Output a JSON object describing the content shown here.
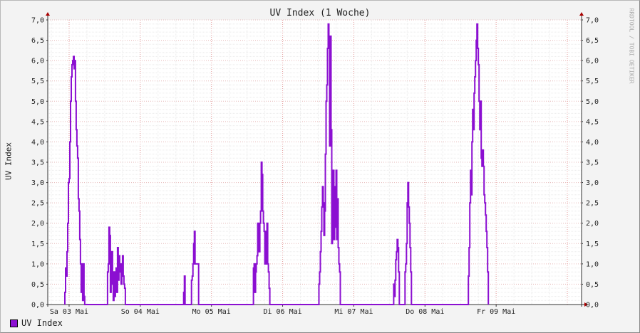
{
  "chart_data": {
    "type": "line",
    "title": "UV Index (1 Woche)",
    "ylabel": "UV Index",
    "watermark": "RRDTOOL / TOBI OETIKER",
    "ylim": [
      0,
      7
    ],
    "y_ticks": [
      "0,0",
      "0,5",
      "1,0",
      "1,5",
      "2,0",
      "2,5",
      "3,0",
      "3,5",
      "4,0",
      "4,5",
      "5,0",
      "5,5",
      "6,0",
      "6,5",
      "7,0"
    ],
    "xlim": [
      -0.3,
      7.2
    ],
    "x_ticks": [
      {
        "x": 0.0,
        "label": "Sa 03 Mai"
      },
      {
        "x": 1.0,
        "label": "So 04 Mai"
      },
      {
        "x": 2.0,
        "label": "Mo 05 Mai"
      },
      {
        "x": 3.0,
        "label": "Di 06 Mai"
      },
      {
        "x": 4.0,
        "label": "Mi 07 Mai"
      },
      {
        "x": 5.0,
        "label": "Do 08 Mai"
      },
      {
        "x": 6.0,
        "label": "Fr 09 Mai"
      }
    ],
    "grid": true,
    "legend": "bottom-left",
    "series": [
      {
        "name": "UV Index",
        "color": "#8b0fd1",
        "points": [
          [
            -0.06,
            0
          ],
          [
            -0.06,
            0.3
          ],
          [
            -0.05,
            0.9
          ],
          [
            -0.04,
            0.7
          ],
          [
            -0.03,
            1.3
          ],
          [
            -0.02,
            2.0
          ],
          [
            -0.01,
            3.0
          ],
          [
            0.0,
            3.1
          ],
          [
            0.01,
            4.0
          ],
          [
            0.02,
            5.0
          ],
          [
            0.03,
            5.6
          ],
          [
            0.04,
            5.9
          ],
          [
            0.05,
            6.0
          ],
          [
            0.06,
            6.1
          ],
          [
            0.07,
            5.8
          ],
          [
            0.08,
            6.0
          ],
          [
            0.09,
            5.0
          ],
          [
            0.1,
            4.3
          ],
          [
            0.11,
            3.9
          ],
          [
            0.12,
            3.6
          ],
          [
            0.13,
            2.6
          ],
          [
            0.14,
            2.3
          ],
          [
            0.15,
            1.6
          ],
          [
            0.16,
            1.0
          ],
          [
            0.17,
            0.3
          ],
          [
            0.18,
            1.0
          ],
          [
            0.19,
            0.1
          ],
          [
            0.2,
            1.0
          ],
          [
            0.21,
            0.2
          ],
          [
            0.22,
            0
          ],
          [
            0.54,
            0
          ],
          [
            0.54,
            0.8
          ],
          [
            0.55,
            1.0
          ],
          [
            0.56,
            1.9
          ],
          [
            0.57,
            1.7
          ],
          [
            0.58,
            0.3
          ],
          [
            0.59,
            1.1
          ],
          [
            0.6,
            1.3
          ],
          [
            0.61,
            0.5
          ],
          [
            0.62,
            0.1
          ],
          [
            0.63,
            0.8
          ],
          [
            0.64,
            0.2
          ],
          [
            0.65,
            0.6
          ],
          [
            0.66,
            0.9
          ],
          [
            0.67,
            0.3
          ],
          [
            0.68,
            1.4
          ],
          [
            0.69,
            0.6
          ],
          [
            0.7,
            1.2
          ],
          [
            0.71,
            0.8
          ],
          [
            0.72,
            1.0
          ],
          [
            0.73,
            0.5
          ],
          [
            0.74,
            0.9
          ],
          [
            0.75,
            1.2
          ],
          [
            0.76,
            0.7
          ],
          [
            0.77,
            0.5
          ],
          [
            0.78,
            0.4
          ],
          [
            0.79,
            0
          ],
          [
            1.61,
            0
          ],
          [
            1.61,
            0.3
          ],
          [
            1.62,
            0.7
          ],
          [
            1.63,
            0
          ],
          [
            1.72,
            0
          ],
          [
            1.72,
            0.6
          ],
          [
            1.73,
            0.7
          ],
          [
            1.74,
            1.0
          ],
          [
            1.75,
            1.5
          ],
          [
            1.76,
            1.8
          ],
          [
            1.77,
            1.0
          ],
          [
            1.81,
            1.0
          ],
          [
            1.82,
            0
          ],
          [
            2.59,
            0
          ],
          [
            2.59,
            0.9
          ],
          [
            2.6,
            1.0
          ],
          [
            2.61,
            0.3
          ],
          [
            2.62,
            0.8
          ],
          [
            2.63,
            1.0
          ],
          [
            2.64,
            1.2
          ],
          [
            2.65,
            2.0
          ],
          [
            2.66,
            1.4
          ],
          [
            2.67,
            1.3
          ],
          [
            2.68,
            2.0
          ],
          [
            2.69,
            2.3
          ],
          [
            2.7,
            3.5
          ],
          [
            2.71,
            3.2
          ],
          [
            2.72,
            2.3
          ],
          [
            2.73,
            2.0
          ],
          [
            2.74,
            1.8
          ],
          [
            2.75,
            1.0
          ],
          [
            2.76,
            1.8
          ],
          [
            2.77,
            1.0
          ],
          [
            2.78,
            2.0
          ],
          [
            2.79,
            1.0
          ],
          [
            2.8,
            0.8
          ],
          [
            2.81,
            0.4
          ],
          [
            2.82,
            0
          ],
          [
            3.51,
            0
          ],
          [
            3.51,
            0.5
          ],
          [
            3.52,
            0.8
          ],
          [
            3.53,
            1.3
          ],
          [
            3.54,
            1.8
          ],
          [
            3.55,
            2.4
          ],
          [
            3.56,
            2.9
          ],
          [
            3.57,
            2.5
          ],
          [
            3.58,
            1.7
          ],
          [
            3.59,
            2.3
          ],
          [
            3.6,
            3.7
          ],
          [
            3.61,
            5.0
          ],
          [
            3.62,
            5.4
          ],
          [
            3.63,
            6.3
          ],
          [
            3.64,
            6.9
          ],
          [
            3.65,
            6.6
          ],
          [
            3.66,
            3.9
          ],
          [
            3.67,
            6.6
          ],
          [
            3.68,
            4.3
          ],
          [
            3.69,
            1.5
          ],
          [
            3.7,
            2.6
          ],
          [
            3.71,
            3.3
          ],
          [
            3.72,
            1.6
          ],
          [
            3.73,
            2.9
          ],
          [
            3.74,
            1.9
          ],
          [
            3.75,
            3.3
          ],
          [
            3.76,
            1.6
          ],
          [
            3.77,
            2.6
          ],
          [
            3.78,
            1.4
          ],
          [
            3.79,
            1.0
          ],
          [
            3.8,
            0.8
          ],
          [
            3.81,
            0
          ],
          [
            4.56,
            0
          ],
          [
            4.56,
            0.5
          ],
          [
            4.57,
            0.2
          ],
          [
            4.58,
            0.6
          ],
          [
            4.59,
            1.1
          ],
          [
            4.6,
            1.3
          ],
          [
            4.61,
            1.6
          ],
          [
            4.62,
            1.4
          ],
          [
            4.63,
            0.8
          ],
          [
            4.64,
            0
          ],
          [
            4.72,
            0
          ],
          [
            4.72,
            0.8
          ],
          [
            4.73,
            1.0
          ],
          [
            4.74,
            1.5
          ],
          [
            4.75,
            2.5
          ],
          [
            4.76,
            3.0
          ],
          [
            4.77,
            2.4
          ],
          [
            4.78,
            2.0
          ],
          [
            4.79,
            1.4
          ],
          [
            4.8,
            0.8
          ],
          [
            4.81,
            0
          ],
          [
            5.61,
            0
          ],
          [
            5.61,
            0.7
          ],
          [
            5.62,
            1.4
          ],
          [
            5.63,
            2.5
          ],
          [
            5.64,
            3.3
          ],
          [
            5.65,
            2.7
          ],
          [
            5.66,
            4.0
          ],
          [
            5.67,
            4.8
          ],
          [
            5.68,
            4.3
          ],
          [
            5.69,
            5.2
          ],
          [
            5.7,
            5.6
          ],
          [
            5.71,
            6.0
          ],
          [
            5.72,
            6.5
          ],
          [
            5.73,
            6.9
          ],
          [
            5.74,
            6.3
          ],
          [
            5.75,
            5.9
          ],
          [
            5.76,
            5.0
          ],
          [
            5.77,
            4.3
          ],
          [
            5.78,
            5.0
          ],
          [
            5.79,
            3.6
          ],
          [
            5.8,
            3.4
          ],
          [
            5.81,
            3.8
          ],
          [
            5.82,
            3.4
          ],
          [
            5.83,
            2.7
          ],
          [
            5.84,
            2.5
          ],
          [
            5.85,
            2.2
          ],
          [
            5.86,
            1.8
          ],
          [
            5.87,
            1.4
          ],
          [
            5.88,
            0.8
          ],
          [
            5.89,
            0
          ]
        ]
      }
    ]
  }
}
